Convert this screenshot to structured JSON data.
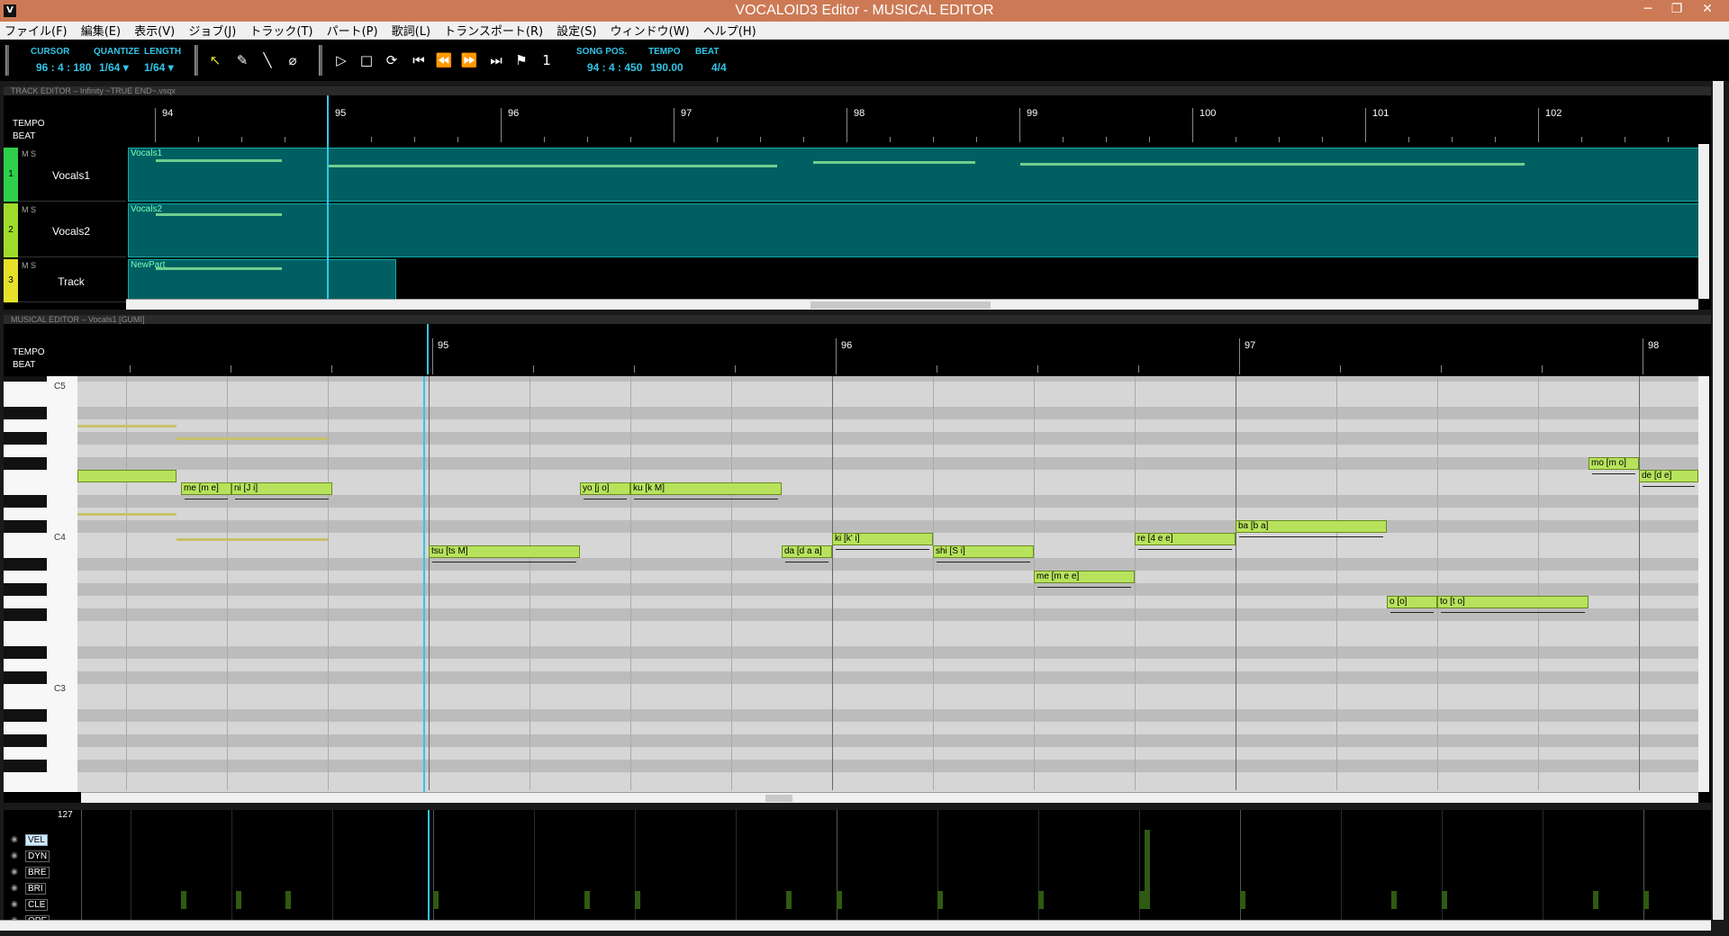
{
  "window": {
    "title": "VOCALOID3 Editor - MUSICAL EDITOR",
    "icon": "V",
    "minimize": "─",
    "restore": "❐",
    "close": "✕"
  },
  "menu": [
    "ファイル(F)",
    "編集(E)",
    "表示(V)",
    "ジョブ(J)",
    "トラック(T)",
    "パート(P)",
    "歌詞(L)",
    "トランスポート(R)",
    "設定(S)",
    "ウィンドウ(W)",
    "ヘルプ(H)"
  ],
  "toolbar": {
    "cursor_label": "CURSOR",
    "cursor_value": "96 : 4 : 180",
    "quantize_label": "QUANTIZE",
    "quantize_value": "1/64 ▾",
    "length_label": "LENGTH",
    "length_value": "1/64 ▾",
    "songpos_label": "SONG POS.",
    "songpos_value": "94 : 4 : 450",
    "tempo_label": "TEMPO",
    "tempo_value": "190.00",
    "beat_label": "BEAT",
    "beat_value": "4/4",
    "tools": [
      "arrow-tool-icon",
      "pencil-tool-icon",
      "line-tool-icon",
      "eraser-tool-icon"
    ],
    "transport": [
      "play-icon",
      "stop-icon",
      "loop-icon",
      "rewind-start-icon",
      "rewind-icon",
      "fast-forward-icon",
      "forward-end-icon",
      "start-marker-icon",
      "end-marker-icon"
    ]
  },
  "track_editor": {
    "header": "TRACK EDITOR ‒ Infinity ~TRUE END~.vsqx",
    "tempo_label": "TEMPO",
    "beat_label": "BEAT",
    "bars": [
      "94",
      "95",
      "96",
      "97",
      "98",
      "99",
      "100",
      "101",
      "102"
    ],
    "tracks": [
      {
        "num": "1",
        "name": "Vocals1",
        "ms": "M S",
        "color": "#2ecf4a",
        "part": "Vocals1"
      },
      {
        "num": "2",
        "name": "Vocals2",
        "ms": "M S",
        "color": "#9fdc2a",
        "part": "Vocals2"
      },
      {
        "num": "3",
        "name": "Track",
        "ms": "M S",
        "color": "#e6e22a",
        "part": "NewPart"
      }
    ]
  },
  "musical_editor": {
    "header": "MUSICAL EDITOR ‒ Vocals1 [GUMI]",
    "tempo_label": "TEMPO",
    "beat_label": "BEAT",
    "bars": [
      "95",
      "96",
      "97",
      "98"
    ],
    "octaves": [
      "C5",
      "C4",
      "C3"
    ],
    "notes": [
      {
        "lyric": "me [m e]"
      },
      {
        "lyric": "ni [J i]"
      },
      {
        "lyric": "tsu [ts M]"
      },
      {
        "lyric": "yo [j o]"
      },
      {
        "lyric": "ku [k M]"
      },
      {
        "lyric": "da [d a a]"
      },
      {
        "lyric": "ki [k' i]"
      },
      {
        "lyric": "shi [S i]"
      },
      {
        "lyric": "me [m e e]"
      },
      {
        "lyric": "re [4 e e]"
      },
      {
        "lyric": "ba [b a]"
      },
      {
        "lyric": "o [o]"
      },
      {
        "lyric": "to [t o]"
      },
      {
        "lyric": "mo [m o]"
      },
      {
        "lyric": "de [d e]"
      }
    ],
    "note_color": "#b7e35c"
  },
  "control_track": {
    "max_value": "127",
    "tabs": [
      "VEL",
      "DYN",
      "BRE",
      "BRI",
      "CLE",
      "OPE"
    ],
    "active_tab": "VEL"
  },
  "colors": {
    "accent": "#33c5e8",
    "titlebar": "#cc7a55",
    "part": "#005f60",
    "note": "#b7e35c"
  }
}
